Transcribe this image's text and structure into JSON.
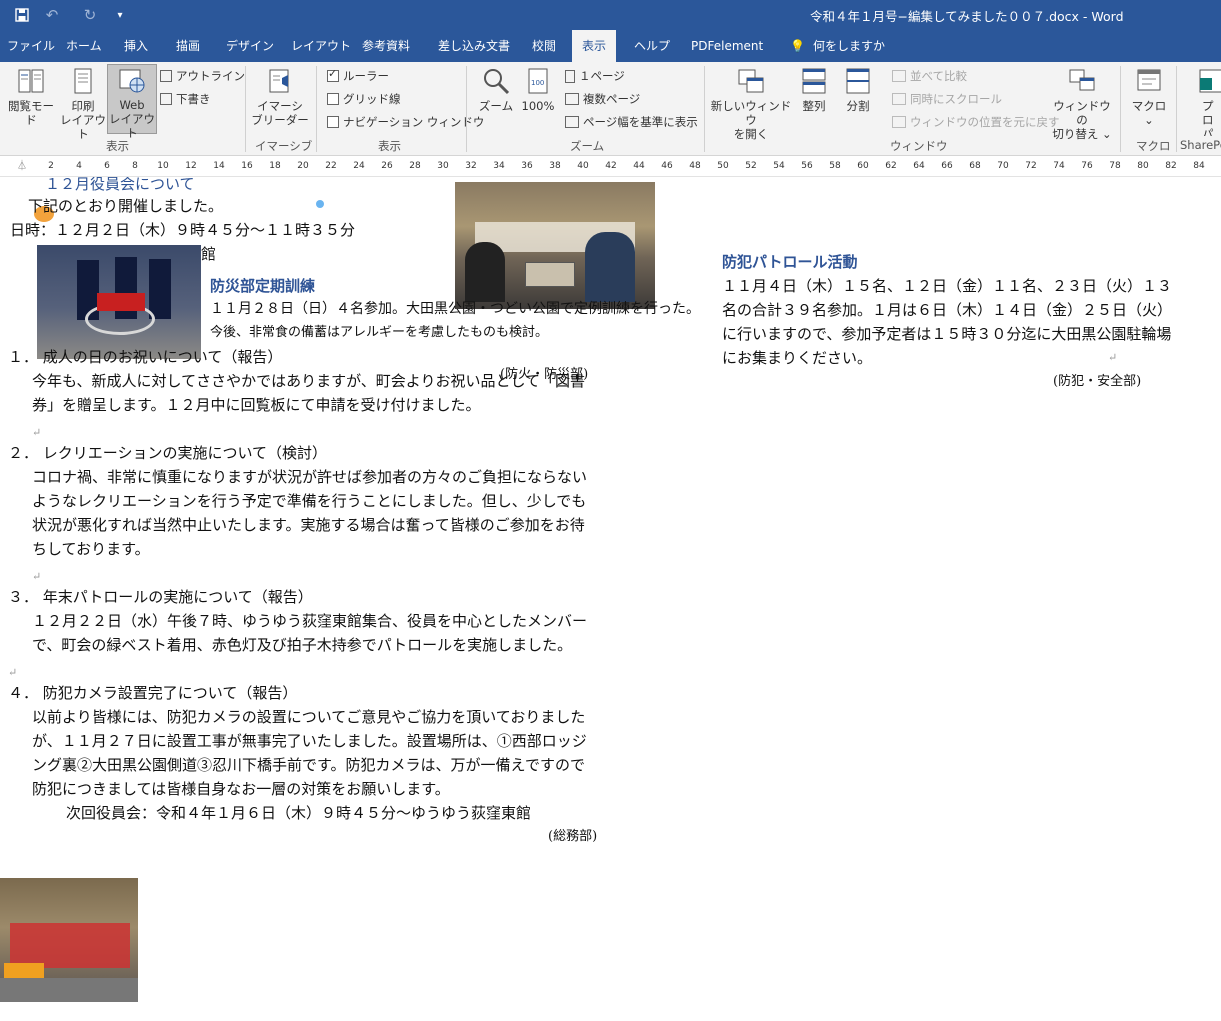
{
  "window": {
    "title": "令和４年１月号−編集してみました００７.docx  -  Word",
    "colors": {
      "accent": "#2b579a",
      "ribbon_bg": "#f3f3f3",
      "heading": "#2f5496"
    }
  },
  "qat": {
    "save_icon": "save-icon",
    "undo_icon": "undo-icon",
    "redo_icon": "redo-icon",
    "customize_icon": "customize-icon"
  },
  "tabs": [
    "ファイル",
    "ホーム",
    "挿入",
    "描画",
    "デザイン",
    "レイアウト",
    "参考資料",
    "差し込み文書",
    "校閲",
    "表示",
    "ヘルプ",
    "PDFelement"
  ],
  "tell_me": "何をしますか",
  "ribbon": {
    "views": {
      "read_mode": "閲覧モード",
      "print_layout_1": "印刷",
      "print_layout_2": "レイアウト",
      "web_layout_1": "Web",
      "web_layout_2": "レイアウト",
      "outline": "アウトライン",
      "draft": "下書き",
      "group": "表示"
    },
    "immersive": {
      "label_1": "イマーシ",
      "label_2": "ブリーダー",
      "group": "イマーシブ"
    },
    "show": {
      "ruler": "ルーラー",
      "gridlines": "グリッド線",
      "nav_pane": "ナビゲーション ウィンドウ",
      "group": "表示"
    },
    "zoom": {
      "zoom": "ズーム",
      "hundred": "100%",
      "one_page": "１ページ",
      "multi_page": "複数ページ",
      "page_width": "ページ幅を基準に表示",
      "group": "ズーム"
    },
    "window": {
      "new_window_1": "新しいウィンドウ",
      "new_window_2": "を開く",
      "arrange": "整列",
      "split": "分割",
      "side_by_side": "並べて比較",
      "sync_scroll": "同時にスクロール",
      "reset_position": "ウィンドウの位置を元に戻す",
      "switch_1": "ウィンドウの",
      "switch_2": "切り替え",
      "group": "ウィンドウ"
    },
    "macros": {
      "label": "マクロ",
      "group": "マクロ"
    },
    "sharepoint": {
      "label_1": "プロ",
      "label_2": "パティ",
      "group": "SharePo"
    }
  },
  "ruler": [
    "2",
    "4",
    "6",
    "8",
    "10",
    "12",
    "14",
    "16",
    "18",
    "20",
    "22",
    "24",
    "26",
    "28",
    "30",
    "32",
    "34",
    "36",
    "38",
    "40",
    "42",
    "44",
    "46",
    "48",
    "50",
    "52",
    "54",
    "56",
    "58",
    "60",
    "62",
    "64",
    "66",
    "68",
    "70",
    "72",
    "74",
    "76",
    "78",
    "80",
    "82",
    "84"
  ],
  "doc": {
    "top_heading": "１２月役員会について",
    "held": "下記のとおり開催しました。",
    "datetime": "日時：１２月２日（木）９時４５分〜１１時３５分",
    "hall": "館",
    "disaster_heading": "防災部定期訓練",
    "disaster_line1": "１１月２８日（日）４名参加。大田黒公園・つどい公園で定例訓練を行った。",
    "disaster_line2": "今後、非常食の備蓄はアレルギーを考慮したものも検討。",
    "disaster_sig": "(防火・防災部)",
    "patrol_heading": "防犯パトロール活動",
    "patrol_line1": "１１月４日（木）１５名、１２日（金）１１名、２３日（火）１３",
    "patrol_line2": "名の合計３９名参加。１月は６日（木）１４日（金）２５日（火）",
    "patrol_line3": "に行いますので、参加予定者は１５時３０分迄に大田黒公園駐輪場",
    "patrol_line4": "にお集まりください。",
    "patrol_sig": "(防犯・安全部)",
    "item1_title": "１．  成人の日のお祝いについて（報告）",
    "item1_line1": "今年も、新成人に対してささやかではありますが、町会よりお祝い品として「図書",
    "item1_line2": "券」を贈呈します。１２月中に回覧板にて申請を受け付けました。",
    "item2_title": "２．  レクリエーションの実施について（検討）",
    "item2_line1": "コロナ禍、非常に慎重になりますが状況が許せば参加者の方々のご負担にならない",
    "item2_line2": "ようなレクリエーションを行う予定で準備を行うことにしました。但し、少しでも",
    "item2_line3": "状況が悪化すれば当然中止いたします。実施する場合は奮って皆様のご参加をお待",
    "item2_line4": "ちしております。",
    "item3_title": "３．  年末パトロールの実施について（報告）",
    "item3_line1": "１２月２２日（水）午後７時、ゆうゆう荻窪東館集合、役員を中心としたメンバー",
    "item3_line2": "で、町会の緑ベスト着用、赤色灯及び拍子木持参でパトロールを実施しました。",
    "item4_title": "４．  防犯カメラ設置完了について（報告）",
    "item4_line1": "以前より皆様には、防犯カメラの設置についてご意見やご協力を頂いておりました",
    "item4_line2": "が、１１月２７日に設置工事が無事完了いたしました。設置場所は、①西部ロッジ",
    "item4_line3": "ング裏②大田黒公園側道③忍川下橋手前です。防犯カメラは、万が一備えですので",
    "item4_line4": "防犯につきましては皆様自身なお一層の対策をお願いします。",
    "next_meeting": "次回役員会：令和４年１月６日（木）９時４５分〜ゆうゆう荻窪東館",
    "general_sig": "(総務部)",
    "para_mark": "↵"
  }
}
